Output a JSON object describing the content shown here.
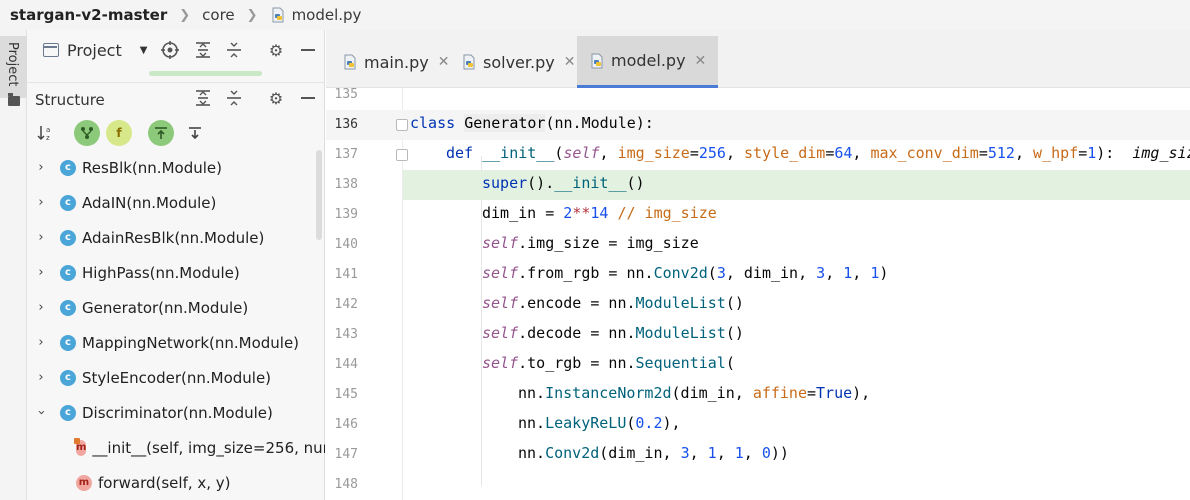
{
  "breadcrumb": {
    "project": "stargan-v2-master",
    "folder": "core",
    "file": "model.py"
  },
  "left_strip": {
    "label": "Project"
  },
  "project_panel": {
    "title": "Project",
    "icons": [
      "target-icon",
      "expand-all-icon",
      "collapse-all-icon",
      "gear-icon",
      "minimize-icon"
    ]
  },
  "structure_panel": {
    "title": "Structure",
    "toolbar": [
      "sort-alpha-icon",
      "show-inherited-icon",
      "show-fields-icon",
      "navigate-from-source-icon",
      "navigate-to-source-icon"
    ],
    "items": [
      {
        "kind": "class",
        "label": "ResBlk(nn.Module)",
        "expanded": false
      },
      {
        "kind": "class",
        "label": "AdaIN(nn.Module)",
        "expanded": false
      },
      {
        "kind": "class",
        "label": "AdainResBlk(nn.Module)",
        "expanded": false
      },
      {
        "kind": "class",
        "label": "HighPass(nn.Module)",
        "expanded": false
      },
      {
        "kind": "class",
        "label": "Generator(nn.Module)",
        "expanded": false
      },
      {
        "kind": "class",
        "label": "MappingNetwork(nn.Module)",
        "expanded": false
      },
      {
        "kind": "class",
        "label": "StyleEncoder(nn.Module)",
        "expanded": false
      },
      {
        "kind": "class",
        "label": "Discriminator(nn.Module)",
        "expanded": true
      },
      {
        "kind": "method",
        "label": "__init__(self, img_size=256, num",
        "private": true
      },
      {
        "kind": "method",
        "label": "forward(self, x, y)",
        "private": false
      }
    ]
  },
  "tabs": [
    {
      "label": "main.py",
      "active": false
    },
    {
      "label": "solver.py",
      "active": false
    },
    {
      "label": "model.py",
      "active": true
    }
  ],
  "editor": {
    "current_line": 136,
    "highlight_line": 138,
    "lines": [
      {
        "n": "135"
      },
      {
        "n": "136"
      },
      {
        "n": "137"
      },
      {
        "n": "138"
      },
      {
        "n": "139"
      },
      {
        "n": "140"
      },
      {
        "n": "141"
      },
      {
        "n": "142"
      },
      {
        "n": "143"
      },
      {
        "n": "144"
      },
      {
        "n": "145"
      },
      {
        "n": "146"
      },
      {
        "n": "147"
      },
      {
        "n": "148"
      }
    ],
    "tokens": {
      "l136": {
        "kw": "class ",
        "name": "Generator",
        "rest": "(nn.Module):"
      },
      "l137": {
        "kw": "def ",
        "fn": "__init__",
        "p1": "(",
        "self": "self",
        "c1": ", ",
        "a1": "img_size",
        "e1": "=",
        "n1": "256",
        "c2": ", ",
        "a2": "style_dim",
        "e2": "=",
        "n2": "64",
        "c3": ", ",
        "a3": "max_conv_dim",
        "e3": "=",
        "n3": "512",
        "c4": ", ",
        "a4": "w_hpf",
        "e4": "=",
        "n4": "1",
        "end": "):",
        "hint": "img_siz"
      },
      "l138": {
        "b": "super",
        "r": "().",
        "f": "__init__",
        "e": "()"
      },
      "l139": {
        "a": "dim_in = ",
        "n1": "2",
        "op": "**",
        "n2": "14",
        "rest": " // img_size"
      },
      "l140": {
        "self": "self",
        "rest": ".img_size = img_size"
      },
      "l141": {
        "self": "self",
        "a": ".from_rgb = nn.",
        "f": "Conv2d",
        "p": "(",
        "n1": "3",
        "m": ", dim_in, ",
        "n2": "3",
        "c1": ", ",
        "n3": "1",
        "c2": ", ",
        "n4": "1",
        "end": ")"
      },
      "l142": {
        "self": "self",
        "a": ".encode = nn.",
        "f": "ModuleList",
        "end": "()"
      },
      "l143": {
        "self": "self",
        "a": ".decode = nn.",
        "f": "ModuleList",
        "end": "()"
      },
      "l144": {
        "self": "self",
        "a": ".to_rgb = nn.",
        "f": "Sequential",
        "end": "("
      },
      "l145": {
        "a": "nn.",
        "f": "InstanceNorm2d",
        "m": "(dim_in, ",
        "k": "affine",
        "e": "=",
        "v": "True",
        "end": "),"
      },
      "l146": {
        "a": "nn.",
        "f": "LeakyReLU",
        "p": "(",
        "n": "0.2",
        "end": "),"
      },
      "l147": {
        "a": "nn.",
        "f": "Conv2d",
        "m": "(dim_in, ",
        "n1": "3",
        "c1": ", ",
        "n2": "1",
        "c2": ", ",
        "n3": "1",
        "c3": ", ",
        "n4": "0",
        "end": "))"
      }
    }
  },
  "colors": {
    "accent_tab": "#4a7bd6",
    "class_icon": "#4aa5d8",
    "method_icon": "#f1a7a0",
    "highlight_line": "#e3f1e0"
  }
}
